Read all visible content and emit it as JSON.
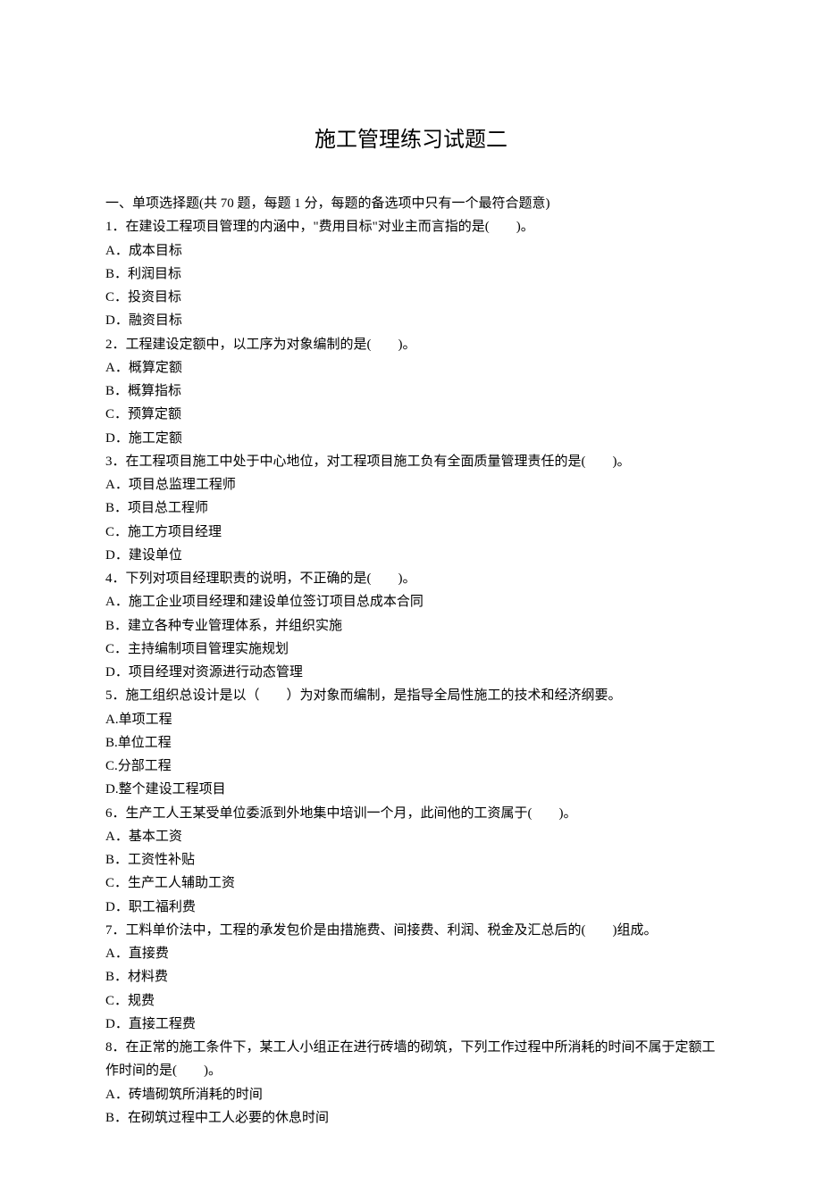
{
  "title": "施工管理练习试题二",
  "section_header": "一、单项选择题(共 70 题，每题 1 分，每题的备选项中只有一个最符合题意)",
  "questions": [
    {
      "stem": "1．在建设工程项目管理的内涵中，\"费用目标\"对业主而言指的是(　　)。",
      "options": [
        "A．成本目标",
        "B．利润目标",
        "C．投资目标",
        "D．融资目标"
      ]
    },
    {
      "stem": "2．工程建设定额中，以工序为对象编制的是(　　)。",
      "options": [
        "A．概算定额",
        "B．概算指标",
        "C．预算定额",
        "D．施工定额"
      ]
    },
    {
      "stem": "3．在工程项目施工中处于中心地位，对工程项目施工负有全面质量管理责任的是(　　)。",
      "options": [
        "A．项目总监理工程师",
        "B．项目总工程师",
        "C．施工方项目经理",
        "D．建设单位"
      ]
    },
    {
      "stem": "4．下列对项目经理职责的说明，不正确的是(　　)。",
      "options": [
        "A．施工企业项目经理和建设单位签订项目总成本合同",
        "B．建立各种专业管理体系，并组织实施",
        "C．主持编制项目管理实施规划",
        "D．项目经理对资源进行动态管理"
      ]
    },
    {
      "stem": "5．施工组织总设计是以（　　）为对象而编制，是指导全局性施工的技术和经济纲要。",
      "options": [
        "A.单项工程",
        "B.单位工程",
        "C.分部工程",
        "D.整个建设工程项目"
      ]
    },
    {
      "stem": "6．生产工人王某受单位委派到外地集中培训一个月，此间他的工资属于(　　)。",
      "options": [
        "A．基本工资",
        "B．工资性补贴",
        "C．生产工人辅助工资",
        "D．职工福利费"
      ]
    },
    {
      "stem": "7．工料单价法中，工程的承发包价是由措施费、间接费、利润、税金及汇总后的(　　)组成。",
      "options": [
        "A．直接费",
        "B．材料费",
        "C．规费",
        "D．直接工程费"
      ]
    },
    {
      "stem": "8．在正常的施工条件下，某工人小组正在进行砖墙的砌筑，下列工作过程中所消耗的时间不属于定额工作时间的是(　　)。",
      "options": [
        "A．砖墙砌筑所消耗的时间",
        "B．在砌筑过程中工人必要的休息时间"
      ]
    }
  ]
}
